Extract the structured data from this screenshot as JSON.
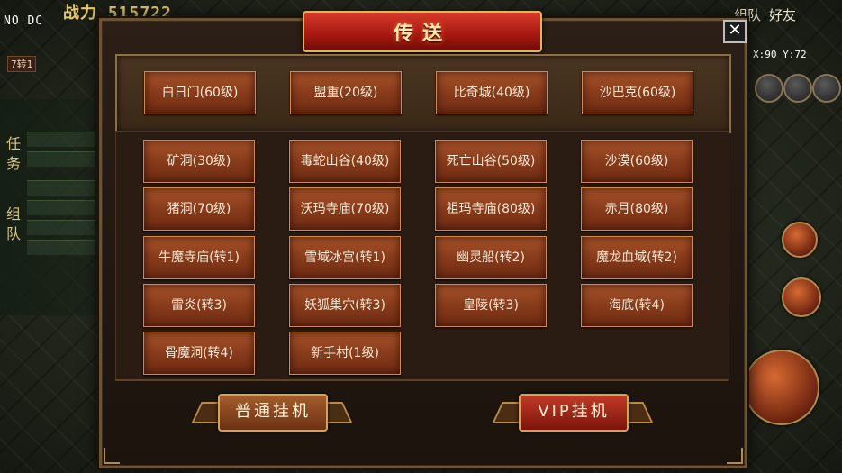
{
  "hud": {
    "debug_text": "NO DC",
    "combat_power": "战力 515722",
    "level_badge": "7转1",
    "side_tabs": [
      "任",
      "务",
      "组",
      "队"
    ],
    "top_right_text": "组队  好友",
    "coords": "X:90 Y:72"
  },
  "dialog": {
    "title": "传送",
    "close_label": "✕",
    "featured": [
      {
        "label": "白日门(60级)"
      },
      {
        "label": "盟重(20级)"
      },
      {
        "label": "比奇城(40级)"
      },
      {
        "label": "沙巴克(60级)"
      }
    ],
    "destinations": [
      {
        "label": "矿洞(30级)"
      },
      {
        "label": "毒蛇山谷(40级)"
      },
      {
        "label": "死亡山谷(50级)"
      },
      {
        "label": "沙漠(60级)"
      },
      {
        "label": "猪洞(70级)"
      },
      {
        "label": "沃玛寺庙(70级)"
      },
      {
        "label": "祖玛寺庙(80级)"
      },
      {
        "label": "赤月(80级)"
      },
      {
        "label": "牛魔寺庙(转1)"
      },
      {
        "label": "雪域冰宫(转1)"
      },
      {
        "label": "幽灵船(转2)"
      },
      {
        "label": "魔龙血域(转2)"
      },
      {
        "label": "雷炎(转3)"
      },
      {
        "label": "妖狐巢穴(转3)"
      },
      {
        "label": "皇陵(转3)"
      },
      {
        "label": "海底(转4)"
      },
      {
        "label": "骨魔洞(转4)"
      },
      {
        "label": "新手村(1级)"
      }
    ],
    "actions": {
      "normal_afk": "普通挂机",
      "vip_afk": "VIP挂机"
    }
  }
}
